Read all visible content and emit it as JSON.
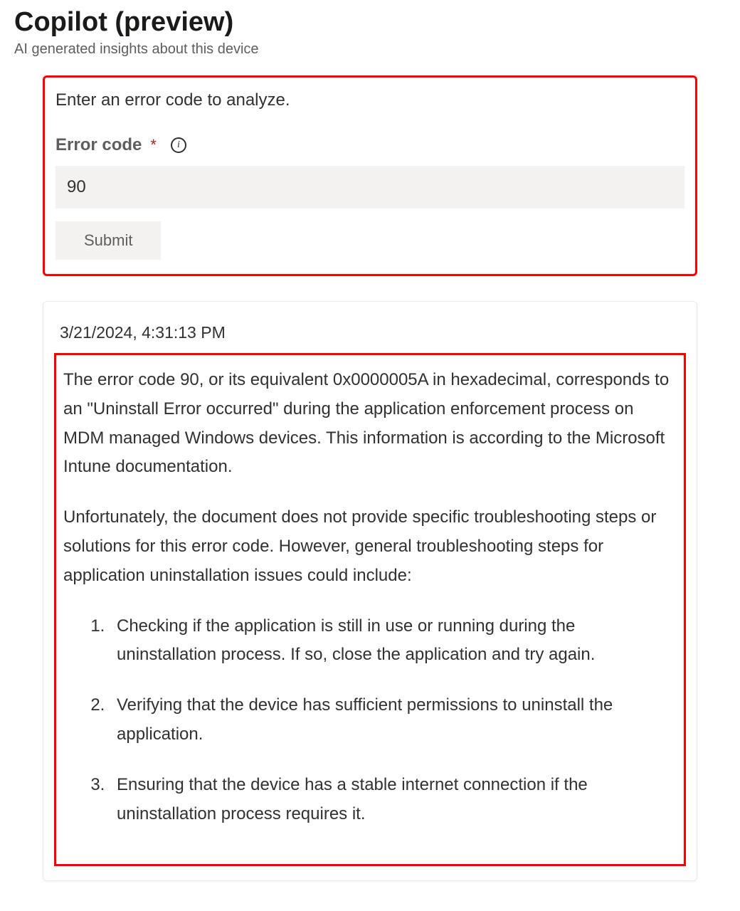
{
  "header": {
    "title": "Copilot (preview)",
    "subtitle": "AI generated insights about this device"
  },
  "input_card": {
    "prompt": "Enter an error code to analyze.",
    "field_label": "Error code",
    "required_indicator": "*",
    "info_icon_name": "info-icon",
    "input_value": "90",
    "submit_label": "Submit"
  },
  "response": {
    "timestamp": "3/21/2024, 4:31:13 PM",
    "paragraph1": "The error code 90, or its equivalent 0x0000005A in hexadecimal, corresponds to an \"Uninstall Error occurred\" during the application enforcement process on MDM managed Windows devices. This information is according to the Microsoft Intune documentation.",
    "paragraph2": "Unfortunately, the document does not provide specific troubleshooting steps or solutions for this error code. However, general troubleshooting steps for application uninstallation issues could include:",
    "steps": [
      "Checking if the application is still in use or running during the uninstallation process. If so, close the application and try again.",
      "Verifying that the device has sufficient permissions to uninstall the application.",
      "Ensuring that the device has a stable internet connection if the uninstallation process requires it."
    ]
  }
}
